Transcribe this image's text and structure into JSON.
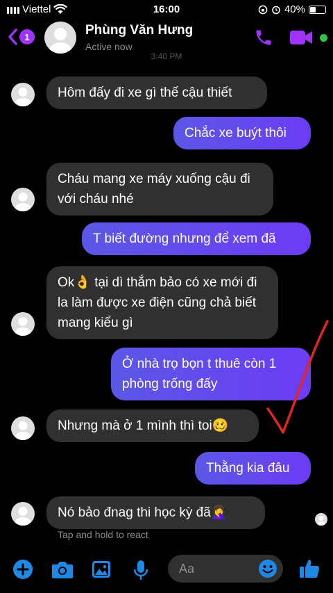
{
  "status_bar": {
    "carrier": "Viettel",
    "time": "16:00",
    "battery": "40%",
    "battery_level": 0.4
  },
  "header": {
    "back_badge": "1",
    "contact_name": "Phùng Văn Hưng",
    "contact_status": "Active now",
    "faded_timestamp": "3:40 PM"
  },
  "messages": [
    {
      "from": "them",
      "text": "Hôm đấy đi xe gì thế cậu thiết"
    },
    {
      "from": "me",
      "text": "Chắc xe buýt thôi"
    },
    {
      "from": "them",
      "text": "Cháu mang xe máy xuống cậu đi với cháu nhé"
    },
    {
      "from": "me",
      "text": "T biết đường nhưng để xem đã"
    },
    {
      "from": "them",
      "text": "Ok👌 tại dì thắm bảo có xe mới đi la làm được xe điện cũng chả biết mang kiểu gì"
    },
    {
      "from": "me",
      "text": "Ở nhà trọ bọn t thuê còn 1 phòng trống đấy"
    },
    {
      "from": "them",
      "text": "Nhưng mà ở 1 mình thì toi🥴"
    },
    {
      "from": "me",
      "text": "Thằng kia đâu"
    },
    {
      "from": "them",
      "text": "Nó bảo đnag thi học kỳ đã🤦‍♀️"
    }
  ],
  "hint": "Tap and hold to react",
  "composer": {
    "placeholder": "Aa"
  },
  "colors": {
    "accent": "#a033ff",
    "composer_icons": "#1e88e5",
    "bubble_in": "#303030",
    "bubble_out": "#6c3cf5",
    "online": "#31c44a",
    "annotation": "#e0261d"
  }
}
